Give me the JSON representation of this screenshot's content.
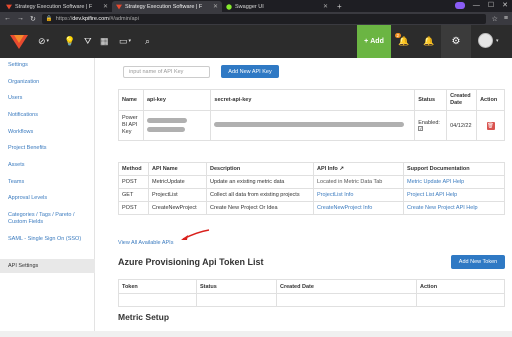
{
  "browser": {
    "tabs": [
      {
        "title": "Strategy Execution Software | F",
        "icon": "kpifire-logo",
        "active": false
      },
      {
        "title": "Strategy Execution Software | F",
        "icon": "kpifire-logo",
        "active": true
      },
      {
        "title": "Swagger UI",
        "icon": "swagger-logo",
        "active": false
      }
    ],
    "url_prefix": "https://",
    "url_domain": "dev.kpifire.com",
    "url_path": "/#/admin/api"
  },
  "header": {
    "add_label": "Add",
    "notification_count": "2"
  },
  "sidebar": {
    "items": [
      {
        "label": "Settings"
      },
      {
        "label": "Organization"
      },
      {
        "label": "Users"
      },
      {
        "label": "Notifications"
      },
      {
        "label": "Workflows"
      },
      {
        "label": "Project Benefits"
      },
      {
        "label": "Assets"
      },
      {
        "label": "Teams"
      },
      {
        "label": "Approval Levels"
      },
      {
        "label": "Categories / Tags / Pareto / Custom Fields"
      },
      {
        "label": "SAML - Single Sign On (SSO)"
      },
      {
        "label": "API Settings"
      }
    ]
  },
  "apikey": {
    "placeholder": "input name of API Key",
    "add_button": "Add New API Key",
    "columns": {
      "name": "Name",
      "api_key": "api-key",
      "secret": "secret-api-key",
      "status": "Status",
      "created": "Created Date",
      "action": "Action"
    },
    "row": {
      "name": "Power BI API Key",
      "status": "Enabled:",
      "created": "04/12/22"
    }
  },
  "api_table": {
    "columns": [
      "Method",
      "API Name",
      "Description",
      "API Info",
      "Support Documentation"
    ],
    "rows": [
      {
        "method": "POST",
        "name": "MetricUpdate",
        "description": "Update an existing metric data",
        "info": "Located in Metric Data Tab",
        "doc": "Metric Update API Help"
      },
      {
        "method": "GET",
        "name": "ProjectList",
        "description": "Collect all data from existing projects",
        "info": "ProjectList Info",
        "doc": "Project List API Help"
      },
      {
        "method": "POST",
        "name": "CreateNewProject",
        "description": "Create New Project Or Idea",
        "info": "CreateNewProject Info",
        "doc": "Create New Project API Help"
      }
    ]
  },
  "view_all": "View All Available APIs",
  "azure": {
    "title": "Azure Provisioning Api Token List",
    "add_button": "Add New Token",
    "columns": [
      "Token",
      "Status",
      "Created Date",
      "Action"
    ]
  },
  "metric_setup": {
    "title": "Metric Setup"
  },
  "colors": {
    "accent": "#2f79c4",
    "link": "#3b7bbf",
    "add_green": "#6bb543",
    "danger": "#d9534f",
    "annotation_arrow": "#d9201c"
  }
}
